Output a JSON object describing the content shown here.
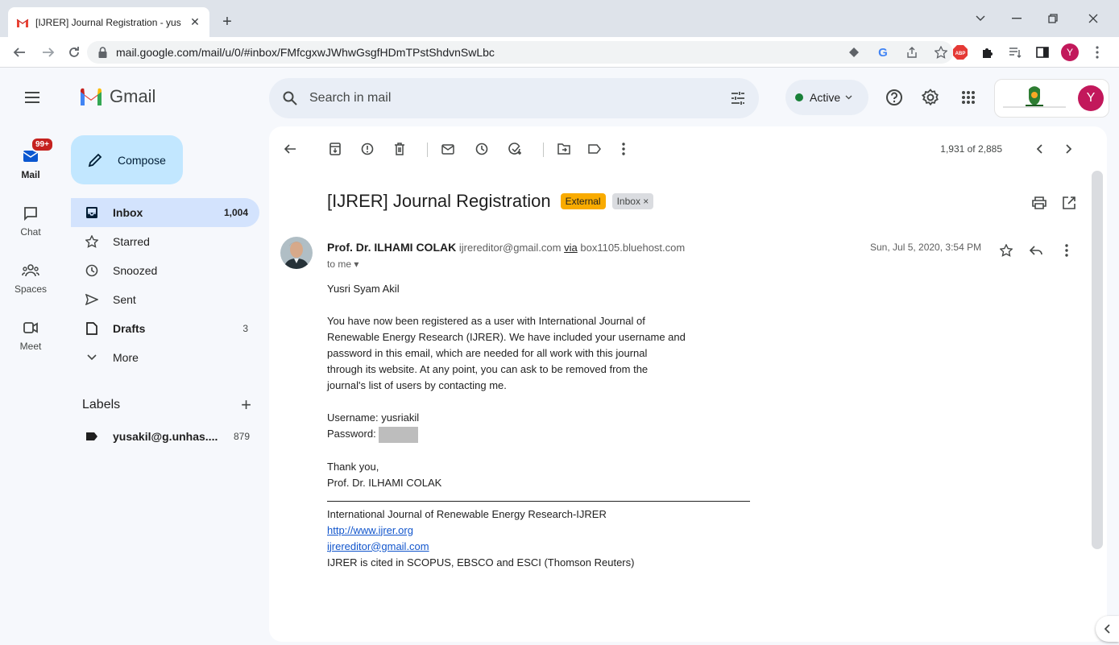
{
  "browser": {
    "tab_title": "[IJRER] Journal Registration - yus",
    "tab_close": "✕",
    "new_tab": "+",
    "url": "mail.google.com/mail/u/0/#inbox/FMfcgxwJWhwGsgfHDmTPstShdvnSwLbc",
    "profile_initial": "Y"
  },
  "header": {
    "logo_text": "Gmail",
    "search_placeholder": "Search in mail",
    "status": "Active",
    "account_initial": "Y"
  },
  "rail": {
    "mail_label": "Mail",
    "mail_badge": "99+",
    "chat_label": "Chat",
    "spaces_label": "Spaces",
    "meet_label": "Meet"
  },
  "sidebar": {
    "compose": "Compose",
    "items": [
      {
        "label": "Inbox",
        "count": "1,004"
      },
      {
        "label": "Starred",
        "count": ""
      },
      {
        "label": "Snoozed",
        "count": ""
      },
      {
        "label": "Sent",
        "count": ""
      },
      {
        "label": "Drafts",
        "count": "3"
      },
      {
        "label": "More",
        "count": ""
      }
    ],
    "labels_title": "Labels",
    "labels_add": "+",
    "label_items": [
      {
        "label": "yusakil@g.unhas....",
        "count": "879"
      }
    ]
  },
  "message": {
    "pager": "1,931 of 2,885",
    "subject": "[IJRER] Journal Registration",
    "chip_external": "External",
    "chip_inbox": "Inbox ×",
    "sender_name": "Prof. Dr. ILHAMI COLAK",
    "sender_email": "ijrereditor@gmail.com",
    "via_word": "via",
    "via_host": "box1105.bluehost.com",
    "to_me": "to me ▾",
    "date": "Sun, Jul 5, 2020, 3:54 PM",
    "greeting": "Yusri Syam Akil",
    "para_lines": [
      "You have now been registered as a user with International Journal of",
      "Renewable Energy Research (IJRER). We have included your username and",
      "password in this email, which are needed for all work with this journal",
      "through its website. At any point, you can ask to be removed from the",
      "journal's list of users by contacting me."
    ],
    "username_line": "Username: yusriakil",
    "password_label": "Password:",
    "thanks": "Thank you,",
    "signature": "Prof. Dr. ILHAMI COLAK",
    "footer_journal": "International Journal of Renewable Energy Research-IJRER",
    "footer_link": "http://www.ijrer.org",
    "footer_email": "ijrereditor@gmail.com",
    "footer_cited": "IJRER is cited in SCOPUS, EBSCO and ESCI (Thomson Reuters)"
  },
  "colors": {
    "compose_bg": "#c2e7ff",
    "selected_bg": "#d3e3fd",
    "external_chip": "#f9ab00",
    "active_dot": "#188038"
  }
}
